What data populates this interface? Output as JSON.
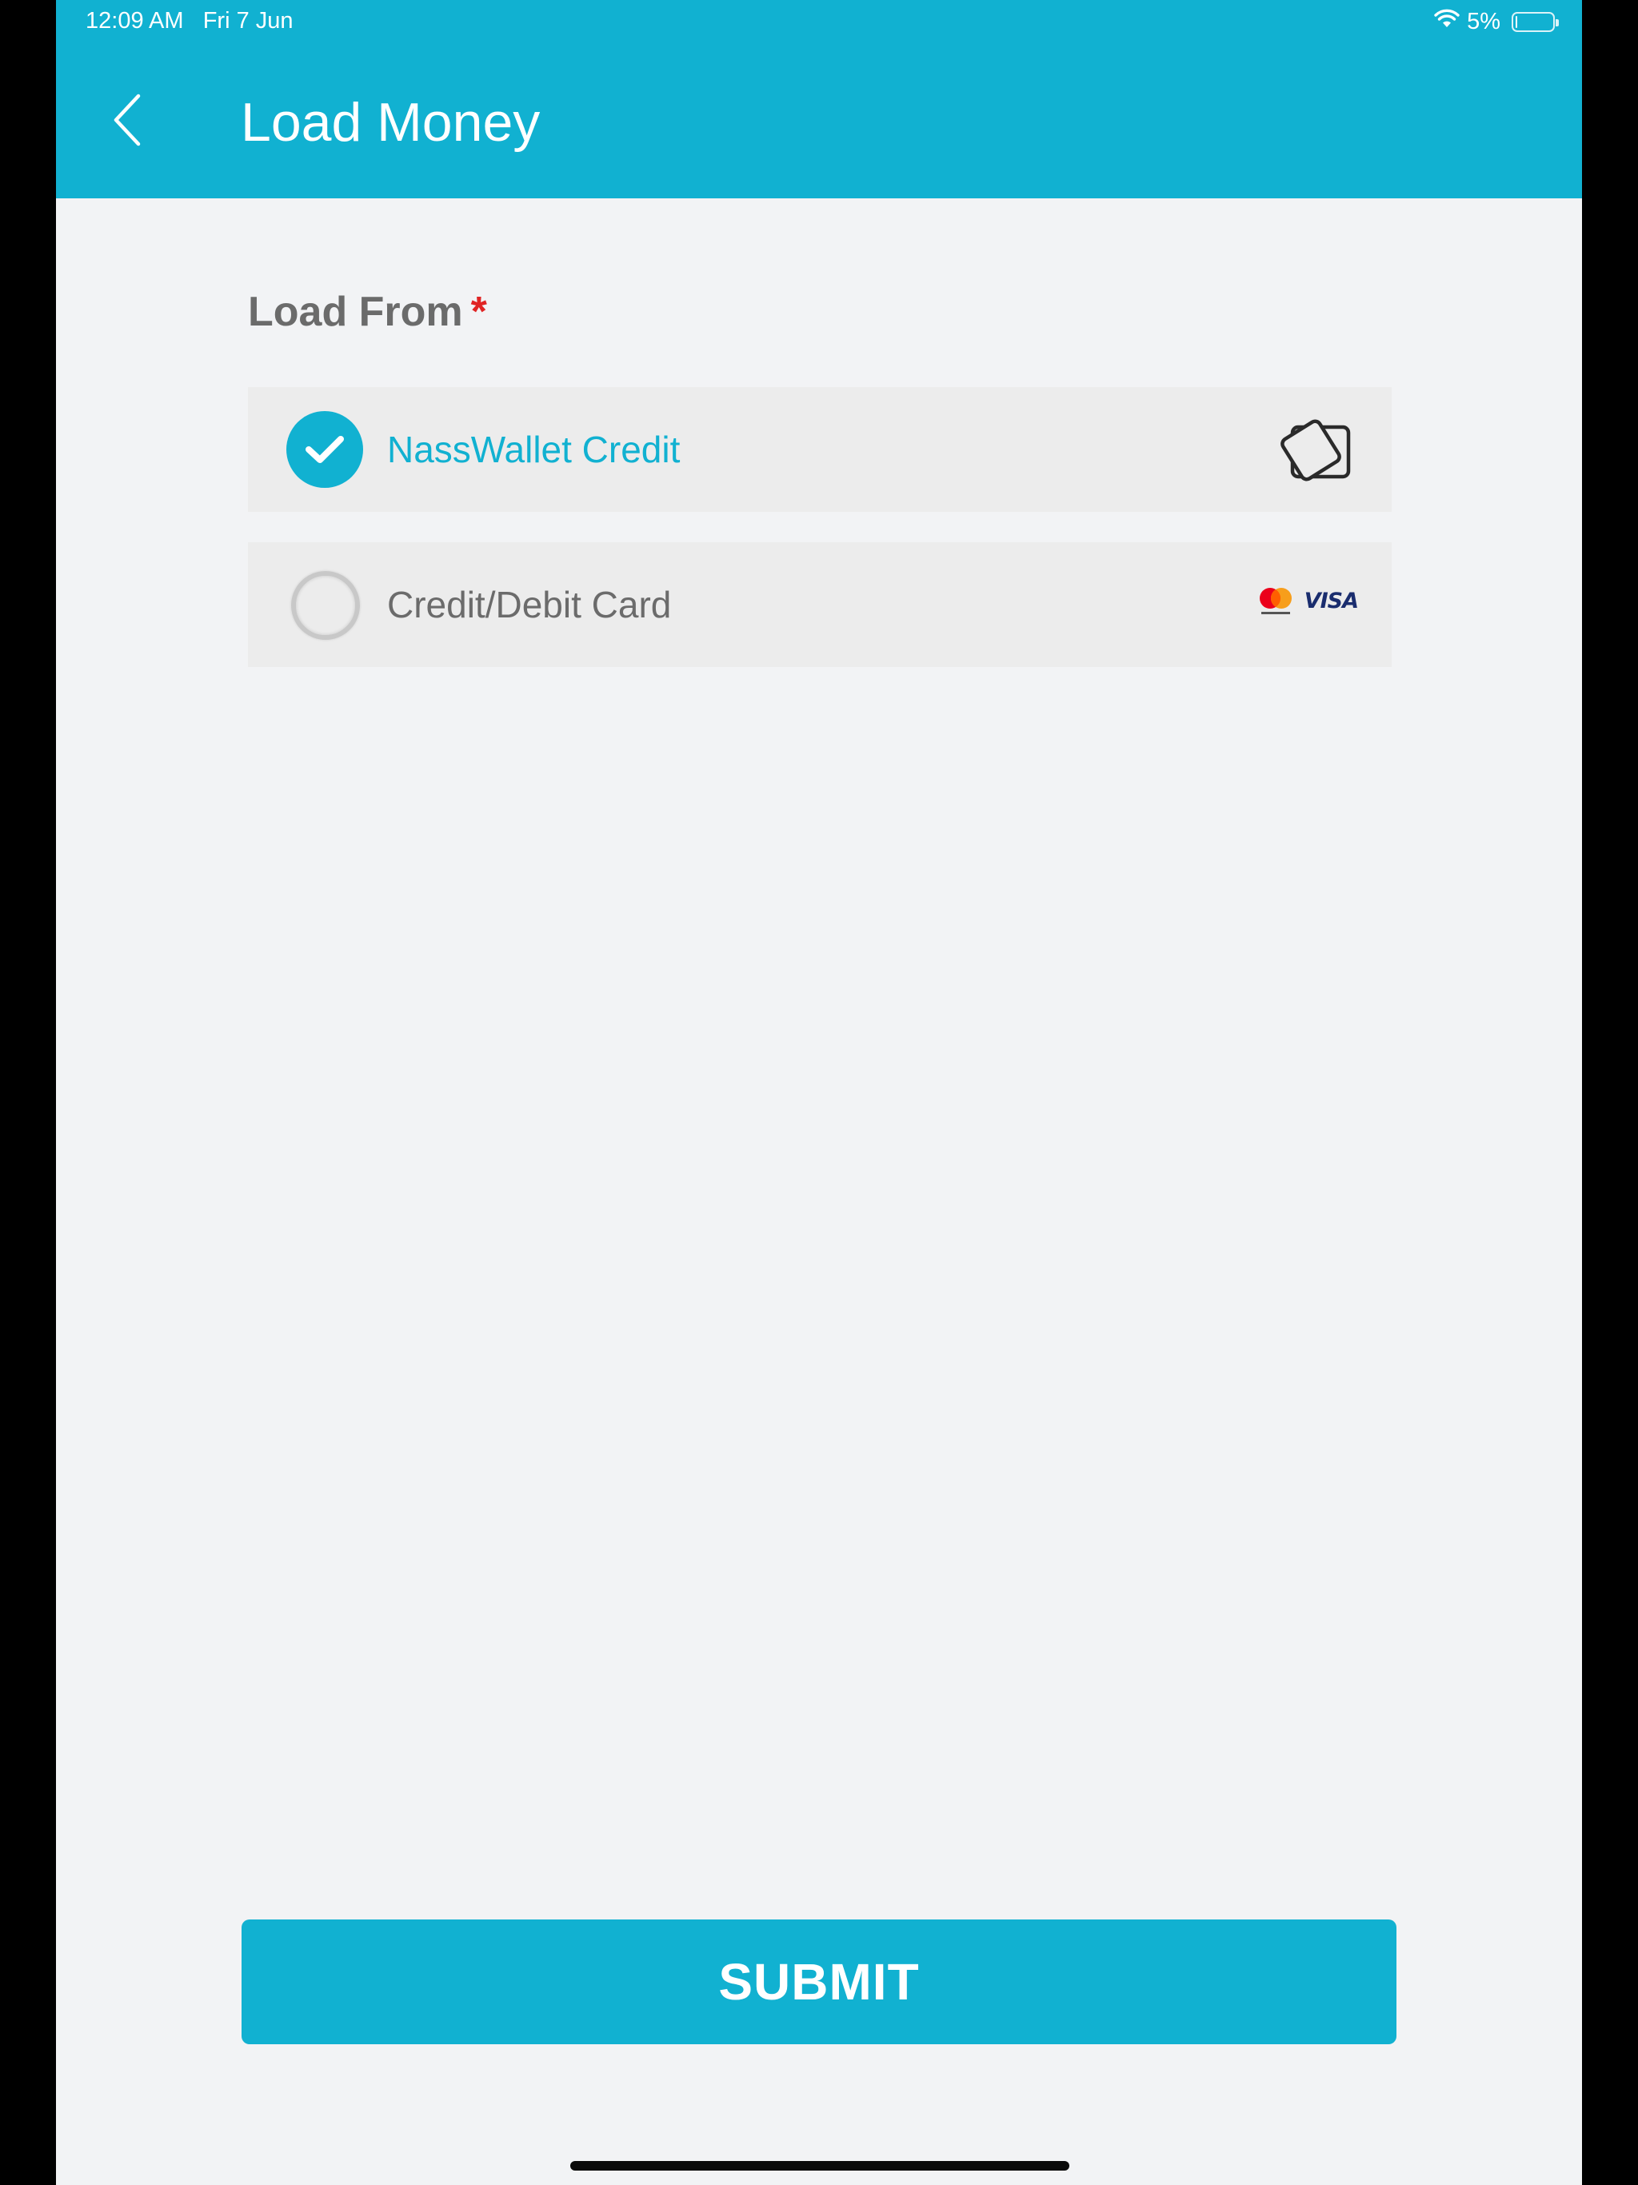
{
  "status_bar": {
    "time": "12:09 AM",
    "date": "Fri 7 Jun",
    "battery_percent_label": "5%",
    "battery_level": 0.05,
    "icons": [
      "wifi-icon",
      "battery-icon"
    ]
  },
  "header": {
    "title": "Load Money",
    "back_icon": "chevron-left-icon"
  },
  "form": {
    "section_label": "Load From",
    "required_marker": "*",
    "options": [
      {
        "label": "NassWallet Credit",
        "selected": true,
        "icon": "wallet-cards-icon"
      },
      {
        "label": "Credit/Debit Card",
        "selected": false,
        "icon": "card-brands-icon",
        "brands": [
          "mastercard",
          "VISA"
        ]
      }
    ]
  },
  "footer": {
    "submit_label": "SUBMIT"
  },
  "colors": {
    "primary": "#11b1d1",
    "background": "#f2f3f5",
    "option_background": "#ececec",
    "label_gray": "#6b6b6b",
    "required_red": "#e02424",
    "visa_blue": "#1a2d6e"
  }
}
